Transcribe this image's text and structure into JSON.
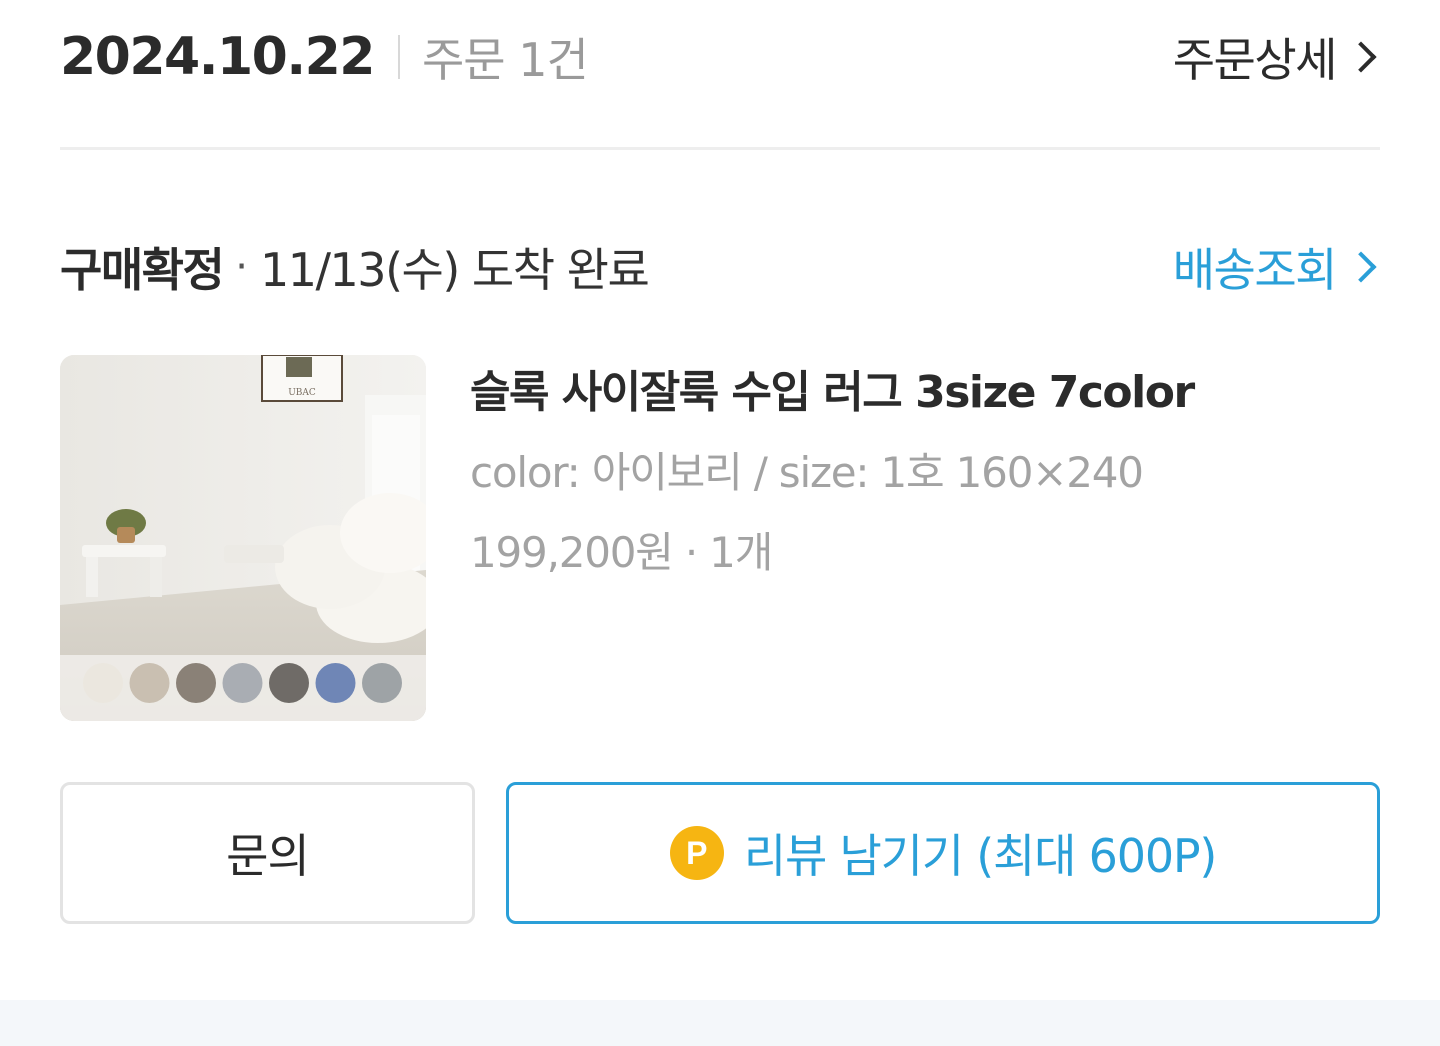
{
  "header": {
    "order_date": "2024.10.22",
    "order_count": "주문 1건",
    "detail_link": "주문상세"
  },
  "status": {
    "label": "구매확정",
    "separator": "·",
    "arrival_text": "11/13(수) 도착 완료",
    "tracking_link": "배송조회"
  },
  "product": {
    "thumbnail_logo": "UBAC",
    "name": "슬록 사이잘룩 수입 러그 3size 7color",
    "option": "color: 아이보리 / size: 1호 160×240",
    "price_qty": "199,200원 · 1개",
    "swatch_colors": [
      "#ebe7df",
      "#c9bfb1",
      "#8a8177",
      "#a9adb3",
      "#6f6b67",
      "#6f86b6",
      "#9ea3a6"
    ]
  },
  "buttons": {
    "inquiry_label": "문의",
    "review_badge": "P",
    "review_label": "리뷰 남기기 (최대 600P)"
  },
  "colors": {
    "accent_blue": "#2a9fd8",
    "point_yellow": "#f6b512",
    "text_dark": "#2b2b2b",
    "text_muted": "#a3a3a3"
  }
}
